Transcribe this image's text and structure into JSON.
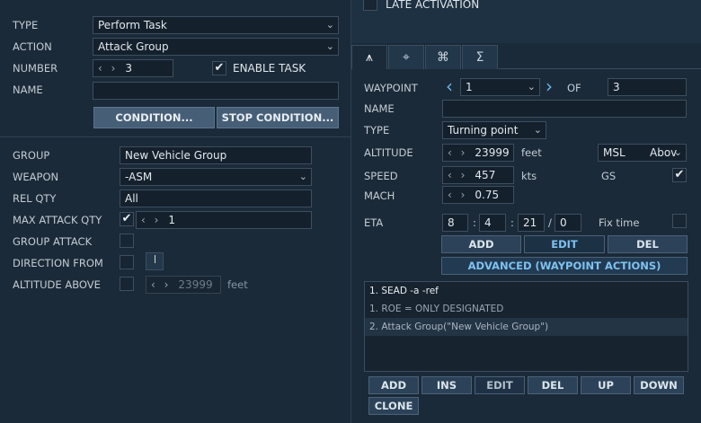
{
  "left": {
    "type_label": "TYPE",
    "type_value": "Perform Task",
    "action_label": "ACTION",
    "action_value": "Attack Group",
    "number_label": "NUMBER",
    "number_value": "3",
    "enable_task_label": "ENABLE TASK",
    "name_label": "NAME",
    "name_value": "",
    "condition_btn": "CONDITION...",
    "stop_condition_btn": "STOP CONDITION...",
    "group_label": "GROUP",
    "group_value": "New Vehicle Group",
    "weapon_label": "WEAPON",
    "weapon_value": "-ASM",
    "rel_qty_label": "REL QTY",
    "rel_qty_value": "All",
    "max_attack_qty_label": "MAX ATTACK QTY",
    "max_attack_qty_value": "1",
    "group_attack_label": "GROUP ATTACK",
    "direction_from_label": "DIRECTION FROM",
    "altitude_above_label": "ALTITUDE ABOVE",
    "altitude_above_value": "23999",
    "altitude_above_unit": "feet"
  },
  "right": {
    "late_activation_label": "LATE ACTIVATION",
    "waypoint_label": "WAYPOINT",
    "waypoint_value": "1",
    "of_label": "OF",
    "of_value": "3",
    "name_label": "NAME",
    "name_value": "",
    "type_label": "TYPE",
    "type_value": "Turning point",
    "altitude_label": "ALTITUDE",
    "altitude_value": "23999",
    "altitude_unit": "feet",
    "alt_ref_value": "MSL",
    "alt_ref_extra": "Abov",
    "speed_label": "SPEED",
    "speed_value": "457",
    "speed_unit": "kts",
    "gs_label": "GS",
    "mach_label": "MACH",
    "mach_value": "0.75",
    "eta_label": "ETA",
    "eta_h": "8",
    "eta_m": "4",
    "eta_s": "21",
    "eta_f": "0",
    "fix_time_label": "Fix time",
    "wp_add": "ADD",
    "wp_edit": "EDIT",
    "wp_del": "DEL",
    "advanced_btn": "ADVANCED (WAYPOINT ACTIONS)",
    "actions": [
      "1. SEAD -a -ref",
      "1. ROE = ONLY DESIGNATED",
      "2. Attack Group(\"New Vehicle Group\")"
    ],
    "list_add": "ADD",
    "list_ins": "INS",
    "list_edit": "EDIT",
    "list_del": "DEL",
    "list_up": "UP",
    "list_down": "DOWN",
    "list_clone": "CLONE"
  },
  "sep": {
    "slash": "/",
    "colon": ":"
  },
  "icons": {
    "check": "✔",
    "chevron_down": "⌄",
    "chevron_left": "‹",
    "chevron_right": "›",
    "spin": "‹ ›",
    "tab1": "⩚",
    "tab2": "⌖",
    "tab3": "⌘",
    "tab4": "Σ"
  },
  "colors": {
    "background": "#1b2a38",
    "accent": "#7ec2f0",
    "button": "#2c4258"
  }
}
